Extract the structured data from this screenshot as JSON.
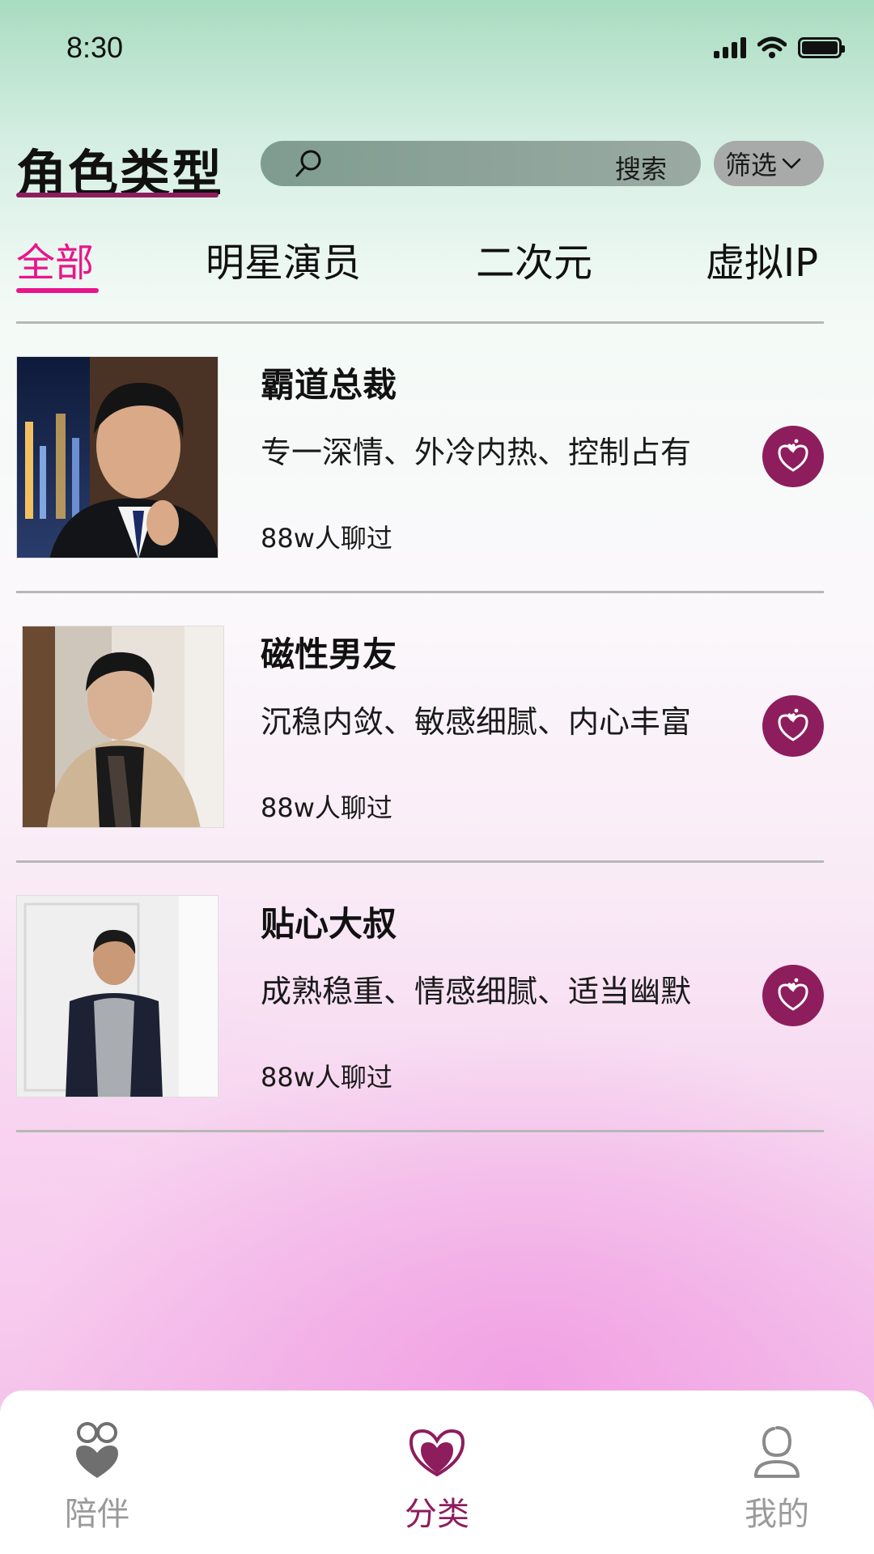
{
  "status_bar": {
    "time": "8:30"
  },
  "header": {
    "title": "角色类型",
    "search_label": "搜索",
    "filter_label": "筛选"
  },
  "tabs": [
    {
      "label": "全部",
      "active": true
    },
    {
      "label": "明星演员",
      "active": false
    },
    {
      "label": "二次元",
      "active": false
    },
    {
      "label": "虚拟IP",
      "active": false
    }
  ],
  "characters": [
    {
      "name": "霸道总裁",
      "tags": "专一深情、外冷内热、控制占有",
      "chat_count": "88w人聊过"
    },
    {
      "name": "磁性男友",
      "tags": "沉稳内敛、敏感细腻、内心丰富",
      "chat_count": "88w人聊过"
    },
    {
      "name": "贴心大叔",
      "tags": "成熟稳重、情感细腻、适当幽默",
      "chat_count": "88w人聊过"
    }
  ],
  "bottom_nav": [
    {
      "label": "陪伴",
      "icon": "companion-icon",
      "active": false
    },
    {
      "label": "分类",
      "icon": "category-heart-icon",
      "active": true
    },
    {
      "label": "我的",
      "icon": "profile-icon",
      "active": false
    }
  ],
  "colors": {
    "accent_pink": "#e7168c",
    "brand_plum": "#8e1d5e",
    "inactive_gray": "#9a9a9a"
  }
}
